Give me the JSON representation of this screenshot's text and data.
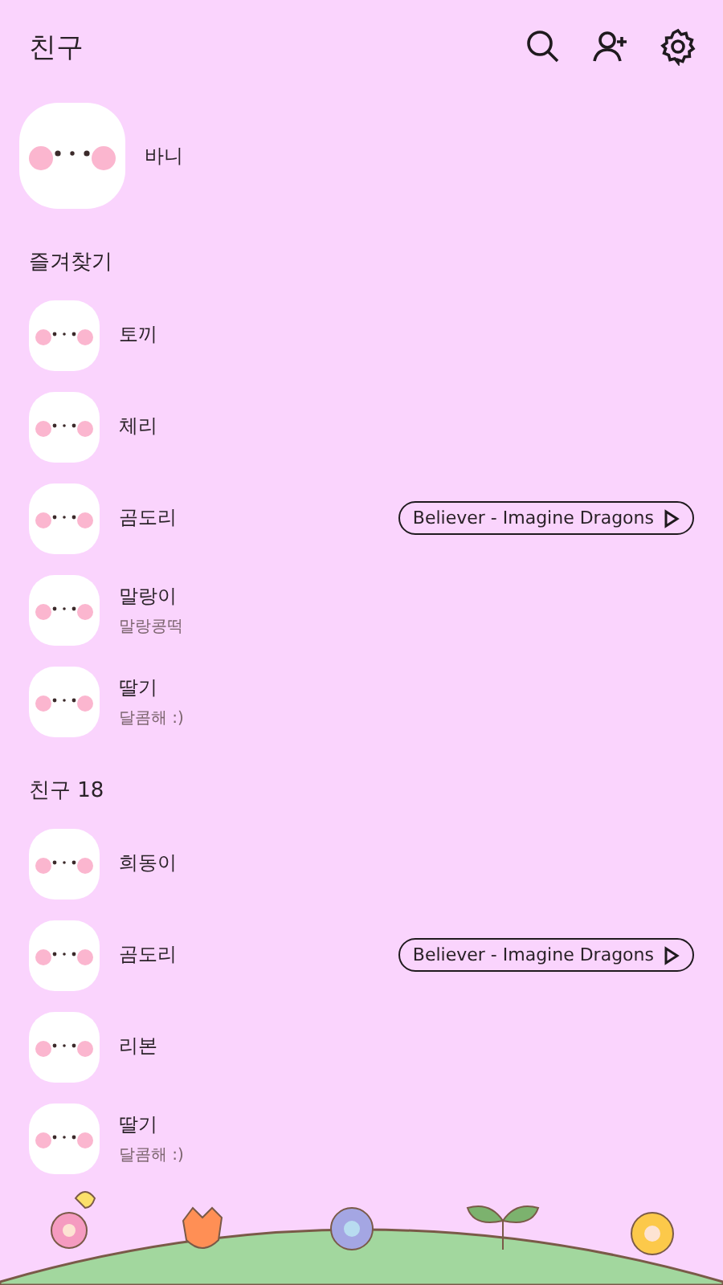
{
  "header": {
    "title": "친구"
  },
  "my_profile": {
    "name": "바니"
  },
  "sections": [
    {
      "title": "즐겨찾기",
      "friends": [
        {
          "name": "토끼"
        },
        {
          "name": "체리"
        },
        {
          "name": "곰도리",
          "music": "Believer - Imagine Dragons"
        },
        {
          "name": "말랑이",
          "status": "말랑콩떡"
        },
        {
          "name": "딸기",
          "status": "달콤해 :)"
        }
      ]
    },
    {
      "title": "친구 18",
      "friends": [
        {
          "name": "희동이"
        },
        {
          "name": "곰도리",
          "music": "Believer - Imagine Dragons"
        },
        {
          "name": "리본"
        },
        {
          "name": "딸기",
          "status": "달콤해 :)"
        }
      ]
    }
  ]
}
